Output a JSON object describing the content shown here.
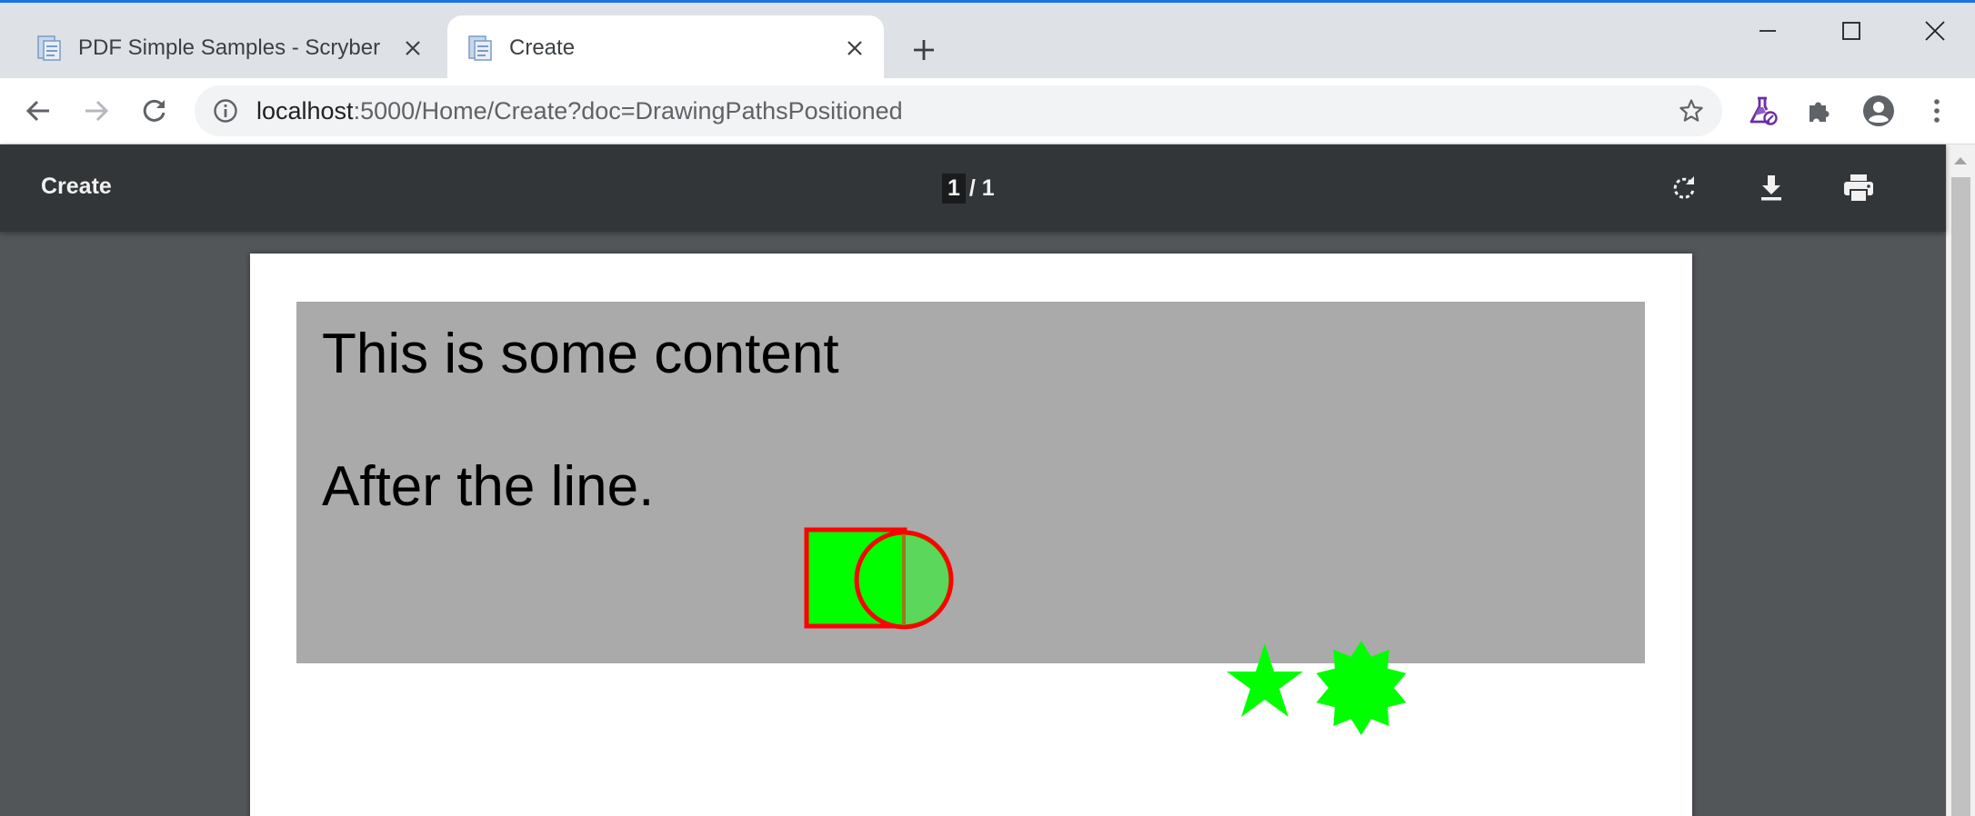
{
  "browser": {
    "tabs": [
      {
        "title": "PDF Simple Samples - Scryber",
        "active": false
      },
      {
        "title": "Create",
        "active": true
      }
    ],
    "new_tab_icon": "plus-icon",
    "window_controls": [
      "minimize-icon",
      "maximize-icon",
      "close-icon"
    ],
    "address_bar": {
      "host": "localhost",
      "rest": ":5000/Home/Create?doc=DrawingPathsPositioned"
    },
    "extensions": [
      "labs-flask-icon",
      "puzzle-extensions-icon",
      "account-avatar-icon",
      "more-menu-icon"
    ]
  },
  "pdf_viewer": {
    "title": "Create",
    "page_current": "1",
    "page_separator": "/ 1",
    "actions": [
      "rotate-icon",
      "download-icon",
      "print-icon"
    ]
  },
  "document": {
    "line1": "This is some content",
    "line2": "After the line.",
    "block_color": "#aaaaaa",
    "shape_fill": "#00ff00",
    "shape_stroke": "#ff0000",
    "circle_overlap_fill": "#5bd75b"
  },
  "colors": {
    "accent": "#1a73e8",
    "tabstrip": "#dee1e6",
    "pdf_toolbar": "#323639",
    "viewer_bg": "#525659"
  }
}
